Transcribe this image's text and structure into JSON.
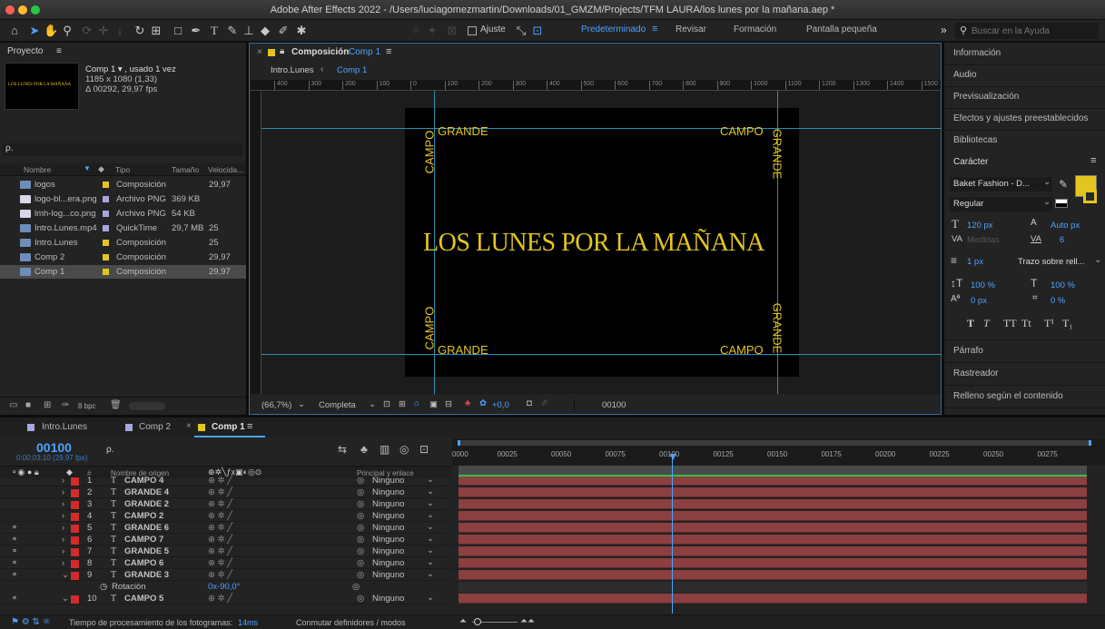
{
  "window": {
    "title": "Adobe After Effects 2022 - /Users/luciagomezmartin/Downloads/01_GMZM/Projects/TFM LAURA/los lunes por la mañana.aep *"
  },
  "toolbar": {
    "snap_label": "Ajuste",
    "workspaces": [
      "Predeterminado",
      "Revisar",
      "Formación",
      "Pantalla pequeña"
    ],
    "workspace_menu": "≡",
    "overflow": "»",
    "help_search_placeholder": "Buscar en la Ayuda"
  },
  "project": {
    "title": "Proyecto",
    "menu": "≡",
    "thumb_text": "LOS LUNES POR LA MAÑANA",
    "comp_name": "Comp 1 ▾ , usado 1 vez",
    "comp_size": "1185 x 1080 (1,33)",
    "comp_duration": "Δ 00292, 29,97 fps",
    "search_icon": "ρ.",
    "columns": {
      "name": "Nombre",
      "type": "Tipo",
      "size": "Tamaño",
      "speed": "Velocida..."
    },
    "items": [
      {
        "name": "logos",
        "type": "Composición",
        "size": "",
        "speed": "29,97",
        "icon": "folder-comp",
        "color": "#e3c51f"
      },
      {
        "name": "logo-bl...era.png",
        "type": "Archivo PNG",
        "size": "369 KB",
        "speed": "",
        "icon": "png",
        "color": "#a7a7e0"
      },
      {
        "name": "lmh-log...co.png",
        "type": "Archivo PNG",
        "size": "54 KB",
        "speed": "",
        "icon": "png",
        "color": "#a7a7e0"
      },
      {
        "name": "Intro.Lunes.mp4",
        "type": "QuickTime",
        "size": "29,7 MB",
        "speed": "25",
        "icon": "video",
        "color": "#a7a7e0"
      },
      {
        "name": "Intro.Lunes",
        "type": "Composición",
        "size": "",
        "speed": "25",
        "icon": "comp",
        "color": "#e3c51f"
      },
      {
        "name": "Comp 2",
        "type": "Composición",
        "size": "",
        "speed": "29,97",
        "icon": "comp",
        "color": "#e3c51f"
      },
      {
        "name": "Comp 1",
        "type": "Composición",
        "size": "",
        "speed": "29,97",
        "icon": "comp",
        "color": "#e3c51f"
      }
    ],
    "bpc": "8 bpc"
  },
  "composition": {
    "panel_label": "Composición",
    "comp_name": "Comp 1",
    "menu": "≡",
    "breadcrumb": [
      "Intro.Lunes",
      "Comp 1"
    ],
    "ruler_ticks": [
      "400",
      "300",
      "200",
      "100",
      "0",
      "100",
      "200",
      "300",
      "400",
      "500",
      "600",
      "700",
      "800",
      "900",
      "1000",
      "1100",
      "1200",
      "1300",
      "1400",
      "1500"
    ],
    "canvas_texts": {
      "top_left": "GRANDE",
      "top_left_vertical": "CAMPO",
      "top_right": "CAMPO",
      "top_right_vertical": "GRANDE",
      "center": "LOS LUNES POR LA MAÑANA",
      "bottom_left_vertical": "CAMPO",
      "bottom_left": "GRANDE",
      "bottom_right": "CAMPO",
      "bottom_right_vertical": "GRANDE"
    },
    "zoom": "(66,7%)",
    "resolution": "Completa",
    "exposure": "+0,0",
    "timecode": "00100"
  },
  "right_panel": {
    "items": [
      "Información",
      "Audio",
      "Previsualización",
      "Efectos y ajustes preestablecidos",
      "Bibliotecas"
    ],
    "character": {
      "title": "Carácter",
      "menu": "≡",
      "font": "Baket Fashion - D...",
      "style": "Regular",
      "size": "120 px",
      "leading": "Auto px",
      "kerning": "Medidas",
      "tracking": "6",
      "stroke": "1 px",
      "stroke_mode": "Trazo sobre rell...",
      "vscale": "100 %",
      "hscale": "100 %",
      "baseline": "0 px",
      "tsume": "0 %",
      "fill_color": "#e3c51f",
      "typo_buttons": [
        "T",
        "T",
        "TT",
        "Tt",
        "T¹",
        "T₁"
      ]
    },
    "bottom_items": [
      "Párrafo",
      "Rastreador",
      "Relleno según el contenido"
    ]
  },
  "timeline": {
    "tabs": [
      "Intro.Lunes",
      "Comp 2",
      "Comp 1"
    ],
    "tab_menu": "≡",
    "timecode": "00100",
    "timecode_sub": "0:00:03:10 (29,97 fps)",
    "search_icon": "ρ.",
    "col_source": "Nombre de origen",
    "col_parent": "Principal y enlace",
    "col_hash": "#",
    "ruler": [
      "0000",
      "00025",
      "00050",
      "00075",
      "00100",
      "00125",
      "00150",
      "00175",
      "00200",
      "00225",
      "00250",
      "00275"
    ],
    "layers": [
      {
        "num": "1",
        "name": "CAMPO 4",
        "parent": "Ninguno",
        "eye": false
      },
      {
        "num": "2",
        "name": "GRANDE 4",
        "parent": "Ninguno",
        "eye": false
      },
      {
        "num": "3",
        "name": "GRANDE 2",
        "parent": "Ninguno",
        "eye": false
      },
      {
        "num": "4",
        "name": "CAMPO 2",
        "parent": "Ninguno",
        "eye": false
      },
      {
        "num": "5",
        "name": "GRANDE 6",
        "parent": "Ninguno",
        "eye": true
      },
      {
        "num": "6",
        "name": "CAMPO 7",
        "parent": "Ninguno",
        "eye": true
      },
      {
        "num": "7",
        "name": "GRANDE 5",
        "parent": "Ninguno",
        "eye": true
      },
      {
        "num": "8",
        "name": "CAMPO 6",
        "parent": "Ninguno",
        "eye": true
      },
      {
        "num": "9",
        "name": "GRANDE 3",
        "parent": "Ninguno",
        "eye": true
      }
    ],
    "prop_name": "Rotación",
    "prop_value": "0x-90,0°",
    "layer10": {
      "num": "10",
      "name": "CAMPO 5",
      "parent": "Ninguno"
    },
    "status_time": "Tiempo de procesamiento de los fotogramas: ",
    "status_ms": "14ms",
    "toggle_modes": "Conmutar definidores / modos",
    "playhead_fraction": 0.34
  }
}
